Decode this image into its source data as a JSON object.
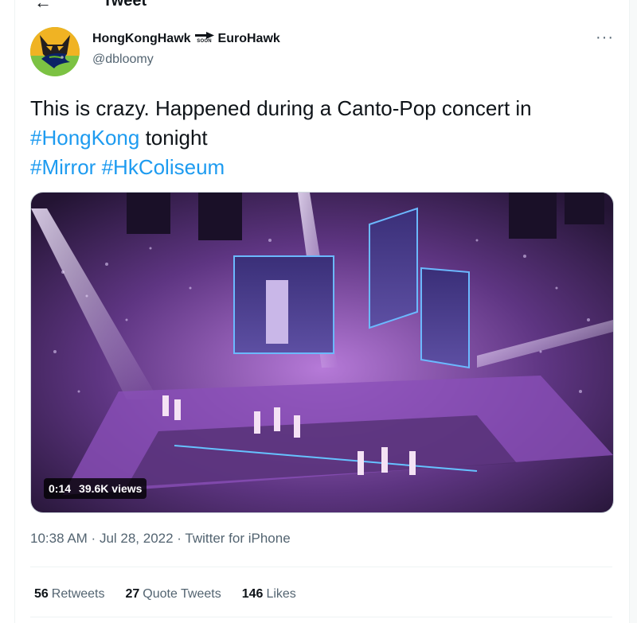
{
  "header": {
    "title": "Tweet",
    "back_icon": "back-arrow-icon"
  },
  "author": {
    "display_name_part1": "HongKongHawk",
    "arrow_label": "SOON",
    "display_name_part2": "EuroHawk",
    "handle": "@dbloomy",
    "avatar_icon": "wolf-seahawk-avatar"
  },
  "tweet": {
    "text_part1": "This is crazy. Happened during a Canto-Pop concert in ",
    "hashtag1": "#HongKong",
    "text_part2": " tonight",
    "hashtag2": "#Mirror",
    "hashtag3": "#HkColiseum"
  },
  "video": {
    "duration": "0:14",
    "views": "39.6K views"
  },
  "meta": {
    "time": "10:38 AM",
    "separator": " · ",
    "date": "Jul 28, 2022",
    "source": "Twitter for iPhone"
  },
  "stats": {
    "retweets_count": "56",
    "retweets_label": "Retweets",
    "quotes_count": "27",
    "quotes_label": "Quote Tweets",
    "likes_count": "146",
    "likes_label": "Likes"
  },
  "colors": {
    "link": "#1d9bf0",
    "secondary_text": "#536471",
    "primary_text": "#0f1419"
  }
}
